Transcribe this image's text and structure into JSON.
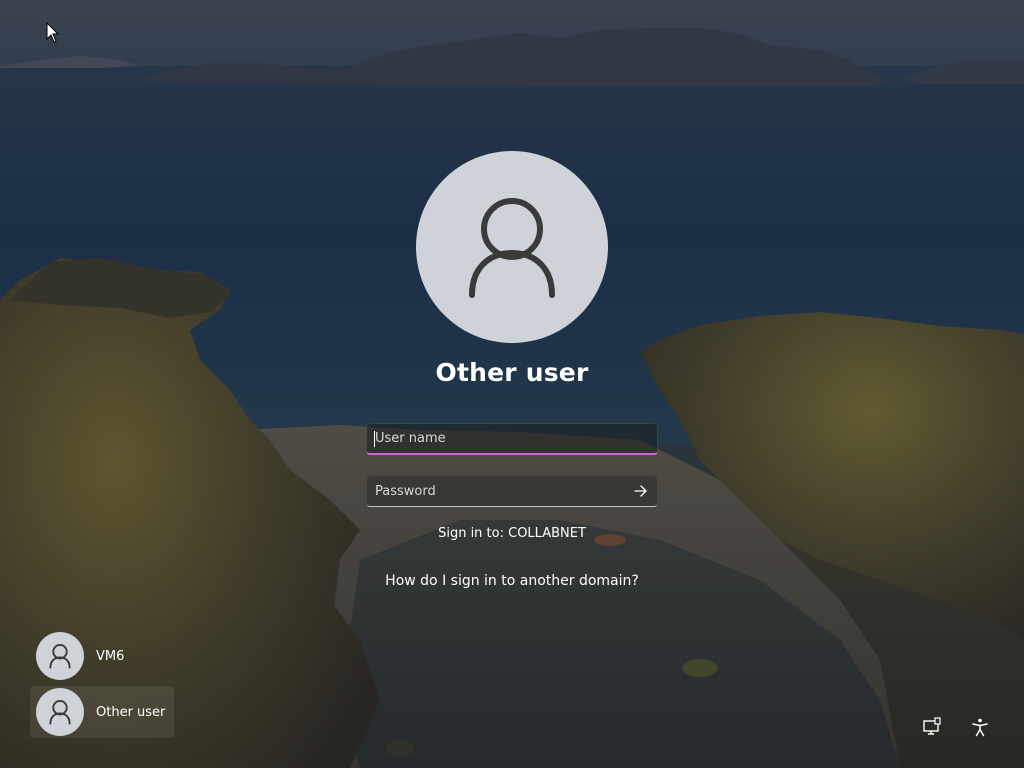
{
  "login": {
    "user_title": "Other user",
    "username": {
      "placeholder": "User name",
      "value": ""
    },
    "password": {
      "placeholder": "Password",
      "value": ""
    },
    "sign_in_to": "Sign in to: COLLABNET",
    "other_domain_link": "How do I sign in to another domain?"
  },
  "user_tiles": [
    {
      "label": "VM6",
      "icon": "user-avatar-icon"
    },
    {
      "label": "Other user",
      "icon": "user-avatar-icon",
      "selected": true
    }
  ],
  "corner_buttons": [
    {
      "icon": "network-icon"
    },
    {
      "icon": "accessibility-icon"
    }
  ],
  "colors": {
    "focus_underline": "#d15fd7",
    "avatar_bg": "#cfd2d8",
    "avatar_glyph": "#3a3a3a"
  }
}
